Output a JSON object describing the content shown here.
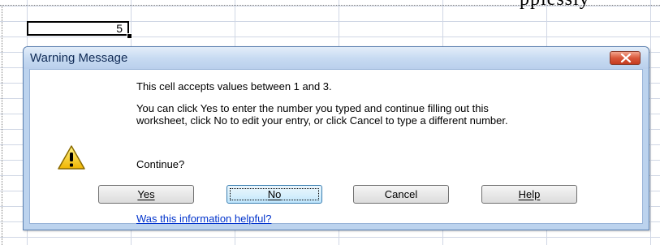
{
  "sheet": {
    "overflow_text": "ppiessly",
    "active_cell_value": "5"
  },
  "dialog": {
    "title": "Warning Message",
    "message_header": "This cell accepts values between 1 and 3.",
    "message_body": "You can click Yes to enter the number you typed and continue filling out this worksheet, click No to edit your entry, or click Cancel to type a different number.",
    "prompt": "Continue?",
    "buttons": {
      "yes": "Yes",
      "no": "No",
      "cancel": "Cancel",
      "help": "Help"
    },
    "help_link": "Was this information helpful?",
    "icon": "warning-icon",
    "colors": {
      "frame": "#bcd3ee",
      "close": "#c53a1f",
      "link": "#0033cc"
    }
  }
}
